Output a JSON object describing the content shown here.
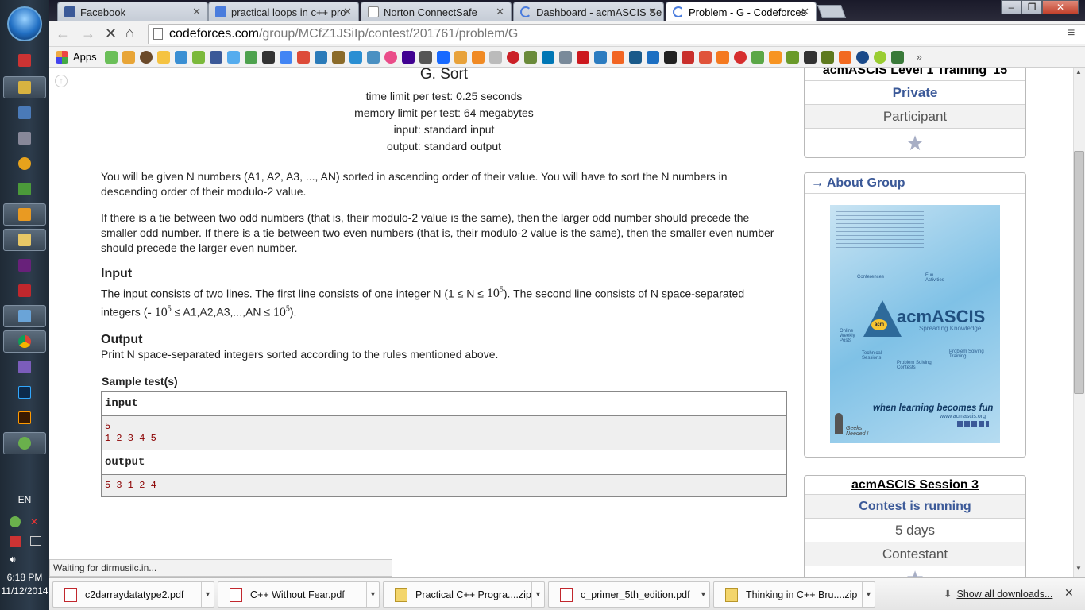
{
  "browser": {
    "tabs": [
      {
        "title": "Facebook",
        "active": false
      },
      {
        "title": "practical loops in c++ pro",
        "active": false
      },
      {
        "title": "Norton ConnectSafe",
        "active": false
      },
      {
        "title": "Dashboard - acmASCIS Se",
        "active": false
      },
      {
        "title": "Problem - G - Codeforces",
        "active": true
      }
    ],
    "url_domain": "codeforces.com",
    "url_path": "/group/MCfZ1JSiIp/contest/201761/problem/G",
    "bookmarks_apps_label": "Apps",
    "status_text": "Waiting for dirmusiic.in..."
  },
  "problem": {
    "title": "G. Sort",
    "time_limit": "time limit per test: 0.25 seconds",
    "memory_limit": "memory limit per test: 64 megabytes",
    "input_file": "input: standard input",
    "output_file": "output: standard output",
    "statement_p1": "You will be given N numbers (A1, A2, A3, ..., AN) sorted in ascending order of their value. You will have to sort the N numbers in descending order of their modulo-2 value.",
    "statement_p2": "If there is a tie between two odd numbers (that is, their modulo-2 value is the same), then the larger odd number should precede the smaller odd number. If there is a tie between two even numbers (that is, their modulo-2 value is the same), then the smaller even number should precede the larger even number.",
    "input_heading": "Input",
    "input_text_a": "The input consists of two lines. The first line consists of one integer N (1 ≤ N ≤ ",
    "input_text_b": "). The second line consists of N space-separated",
    "input_text_c": "integers (",
    "input_text_d": " ≤ A1,A2,A3,...,AN ≤ ",
    "input_text_e": ").",
    "math_neg": "- 10",
    "math_base": "10",
    "math_exp": "5",
    "output_heading": "Output",
    "output_text": "Print N space-separated integers sorted according to the rules mentioned above.",
    "sample_title": "Sample test(s)",
    "sample_input_label": "input",
    "sample_input": "5\n1 2 3 4 5",
    "sample_output_label": "output",
    "sample_output": "5 3 1 2 4"
  },
  "sidebar": {
    "group_title": "acmASCIS Level 1 Training '15",
    "group_type": "Private",
    "role": "Participant",
    "about_heading": "→ About Group",
    "about_image": {
      "brand": "acmASCIS",
      "tagline": "Spreading Knowledge",
      "slogan": "when learning becomes fun",
      "website": "www.acmascis.org",
      "badge": "acm",
      "footer": "Geeks Needed !",
      "bubbles": [
        "Conferences",
        "Fun Activities",
        "Online Weekly Posts",
        "Technical Sessions",
        "Problem Solving Contests",
        "Problem Solving Training"
      ]
    },
    "session_title": "acmASCIS Session 3",
    "session_status": "Contest is running",
    "session_remaining": "5 days",
    "session_role": "Contestant"
  },
  "downloads": [
    {
      "name": "c2darraydatatype2.pdf",
      "kind": "pdf"
    },
    {
      "name": "C++ Without Fear.pdf",
      "kind": "pdf"
    },
    {
      "name": "Practical C++ Progra....zip",
      "kind": "zip"
    },
    {
      "name": "c_primer_5th_edition.pdf",
      "kind": "pdf"
    },
    {
      "name": "Thinking in C++ Bru....zip",
      "kind": "zip"
    }
  ],
  "downloads_show_all": "Show all downloads...",
  "taskbar": {
    "language": "EN",
    "time": "6:18 PM",
    "date": "11/12/2014"
  }
}
